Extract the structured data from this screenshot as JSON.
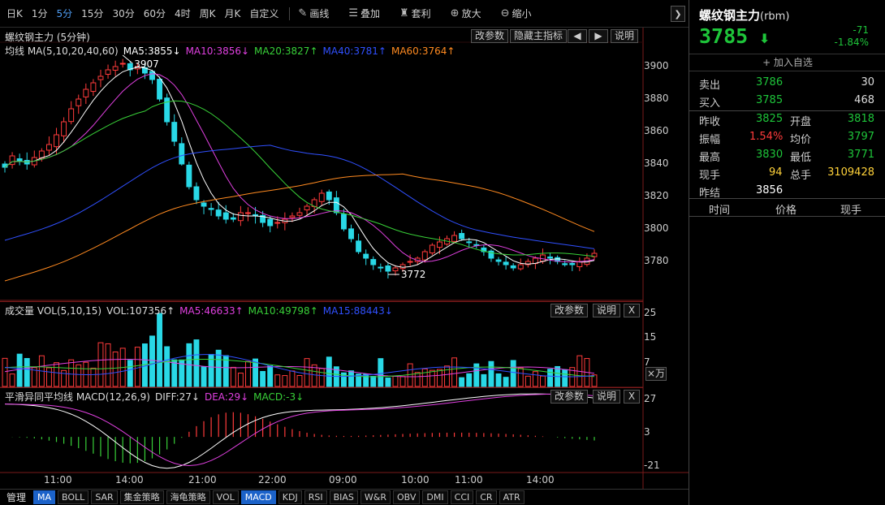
{
  "toolbar": {
    "periods": [
      "日K",
      "1分",
      "5分",
      "15分",
      "30分",
      "60分",
      "4时",
      "周K",
      "月K",
      "自定义"
    ],
    "active_period": "5分",
    "tools": [
      {
        "icon": "pencil-icon",
        "glyph": "✎",
        "label": "画线"
      },
      {
        "icon": "layers-icon",
        "glyph": "☰",
        "label": "叠加"
      },
      {
        "icon": "moneybag-icon",
        "glyph": "♜",
        "label": "套利"
      },
      {
        "icon": "zoom-in-icon",
        "glyph": "⊕",
        "label": "放大"
      },
      {
        "icon": "zoom-out-icon",
        "glyph": "⊖",
        "label": "缩小"
      }
    ],
    "expand_glyph": "❯"
  },
  "main_panel": {
    "title": "螺纹钢主力 (5分钟)",
    "buttons": {
      "params": "改参数",
      "hide": "隐藏主指标",
      "prev": "◀",
      "next": "▶",
      "help": "说明"
    },
    "ma_header": [
      {
        "text": "均线 MA(5,10,20,40,60)",
        "color": "#dddddd"
      },
      {
        "text": "MA5:3855↓",
        "color": "#ffffff"
      },
      {
        "text": "MA10:3856↓",
        "color": "#e040e0"
      },
      {
        "text": "MA20:3827↑",
        "color": "#38d038"
      },
      {
        "text": "MA40:3781↑",
        "color": "#3050ff"
      },
      {
        "text": "MA60:3764↑",
        "color": "#ff8a20"
      }
    ],
    "yticks": [
      "3900",
      "3880",
      "3860",
      "3840",
      "3820",
      "3800",
      "3780"
    ],
    "max_label": "3907",
    "min_label": "3772"
  },
  "vol_panel": {
    "header": [
      {
        "text": "成交量 VOL(5,10,15)",
        "color": "#dddddd"
      },
      {
        "text": "VOL:107356↑",
        "color": "#dddddd"
      },
      {
        "text": "MA5:46633↑",
        "color": "#e040e0"
      },
      {
        "text": "MA10:49798↑",
        "color": "#38d038"
      },
      {
        "text": "MA15:88443↓",
        "color": "#3050ff"
      }
    ],
    "buttons": {
      "params": "改参数",
      "help": "说明",
      "close": "X"
    },
    "yticks": [
      "25",
      "15",
      "7"
    ],
    "unit": "×万"
  },
  "macd_panel": {
    "header": [
      {
        "text": "平滑异同平均线 MACD(12,26,9)",
        "color": "#dddddd"
      },
      {
        "text": "DIFF:27↓",
        "color": "#dddddd"
      },
      {
        "text": "DEA:29↓",
        "color": "#e040e0"
      },
      {
        "text": "MACD:-3↓",
        "color": "#38d038"
      }
    ],
    "buttons": {
      "params": "改参数",
      "help": "说明",
      "close": "X"
    },
    "yticks": [
      "27",
      "3",
      "-21"
    ]
  },
  "time_axis": [
    "11:00",
    "14:00",
    "21:00",
    "22:00",
    "09:00",
    "10:00",
    "11:00",
    "14:00"
  ],
  "bottom_tabs": [
    "管理",
    "MA",
    "BOLL",
    "SAR",
    "集金策略",
    "海龟策略",
    "VOL",
    "MACD",
    "KDJ",
    "RSI",
    "BIAS",
    "W&R",
    "OBV",
    "DMI",
    "CCI",
    "CR",
    "ATR"
  ],
  "active_tabs": [
    "MA",
    "MACD"
  ],
  "quote": {
    "name": "螺纹钢主力",
    "code": "(rbm)",
    "price": "3785",
    "arrow": "⬇",
    "change": "-71",
    "change_pct": "-1.84%",
    "add_label": "+ 加入自选",
    "sell_label": "卖出",
    "sell_price": "3786",
    "sell_vol": "30",
    "buy_label": "买入",
    "buy_price": "3785",
    "buy_vol": "468",
    "prev_close_label": "昨收",
    "prev_close": "3825",
    "open_label": "开盘",
    "open": "3818",
    "amp_label": "振幅",
    "amp": "1.54%",
    "avg_label": "均价",
    "avg": "3797",
    "high_label": "最高",
    "high": "3830",
    "low_label": "最低",
    "low": "3771",
    "cur_vol_label": "现手",
    "cur_vol": "94",
    "total_vol_label": "总手",
    "total_vol": "3109428",
    "settle_label": "昨结",
    "settle": "3856",
    "cols": [
      "时间",
      "价格",
      "现手"
    ]
  },
  "colors": {
    "up": "#ff3b3b",
    "down": "#29d8e6",
    "price_down": "#1ec53a",
    "ma5": "#ffffff",
    "ma10": "#e040e0",
    "ma20": "#38d038",
    "ma40": "#3050ff",
    "ma60": "#ff8a20"
  },
  "chart_data": {
    "type": "candlestick",
    "title": "螺纹钢主力 (5分钟)",
    "price_ylim": [
      3760,
      3910
    ],
    "max": 3907,
    "min": 3772,
    "approx_close_series": [
      3838,
      3845,
      3842,
      3840,
      3844,
      3848,
      3852,
      3858,
      3866,
      3874,
      3880,
      3886,
      3890,
      3894,
      3898,
      3900,
      3902,
      3898,
      3900,
      3896,
      3892,
      3880,
      3866,
      3854,
      3840,
      3826,
      3818,
      3814,
      3812,
      3808,
      3806,
      3806,
      3810,
      3810,
      3808,
      3804,
      3802,
      3804,
      3806,
      3808,
      3810,
      3814,
      3818,
      3822,
      3818,
      3810,
      3800,
      3794,
      3786,
      3782,
      3778,
      3776,
      3774,
      3776,
      3778,
      3780,
      3782,
      3786,
      3790,
      3792,
      3794,
      3796,
      3794,
      3792,
      3790,
      3786,
      3782,
      3780,
      3778,
      3776,
      3778,
      3780,
      3782,
      3784,
      3782,
      3780,
      3778,
      3778,
      3780,
      3782,
      3785
    ],
    "macd_ylim": [
      -21,
      27
    ]
  }
}
